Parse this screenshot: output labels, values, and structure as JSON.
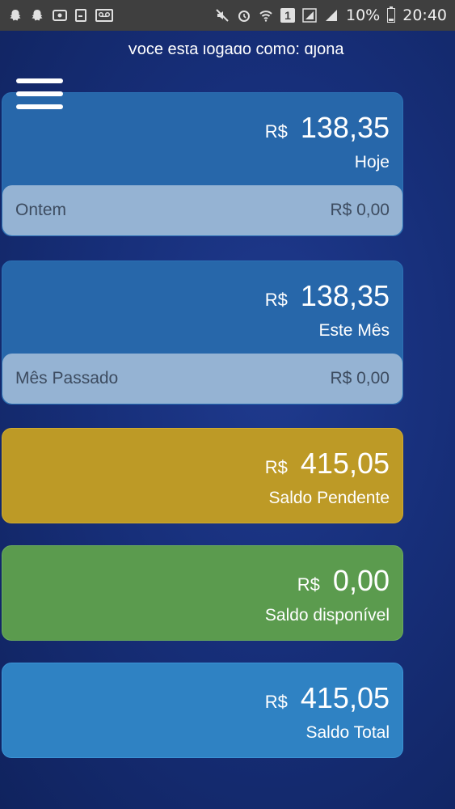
{
  "status_bar": {
    "battery_percent": "10%",
    "time": "20:40",
    "sim_badge": "1",
    "left_icons": [
      "snapchat-icon",
      "snapchat-icon",
      "cast-icon",
      "clipboard-icon",
      "voicemail-icon"
    ],
    "right_icons": [
      "mute-icon",
      "alarm-icon",
      "wifi-icon",
      "sim-icon",
      "signal-icon",
      "signal-icon",
      "battery-icon"
    ]
  },
  "header": {
    "logged_text": "Você está logado como: djona",
    "menu_icon": "hamburger-menu-icon"
  },
  "cards": {
    "today": {
      "currency": "R$",
      "value": "138,35",
      "label": "Hoje",
      "sub_label": "Ontem",
      "sub_value": "R$ 0,00"
    },
    "month": {
      "currency": "R$",
      "value": "138,35",
      "label": "Este Mês",
      "sub_label": "Mês Passado",
      "sub_value": "R$ 0,00"
    },
    "pending": {
      "currency": "R$",
      "value": "415,05",
      "label": "Saldo Pendente"
    },
    "available": {
      "currency": "R$",
      "value": "0,00",
      "label": "Saldo disponível"
    },
    "total": {
      "currency": "R$",
      "value": "415,05",
      "label": "Saldo Total"
    }
  },
  "colors": {
    "background": "#172f7a",
    "card_blue": "#2767aa",
    "card_sub": "#95b3d3",
    "card_gold": "#bd9a26",
    "card_green": "#5b9b4e",
    "card_light_blue": "#2f82c3"
  }
}
